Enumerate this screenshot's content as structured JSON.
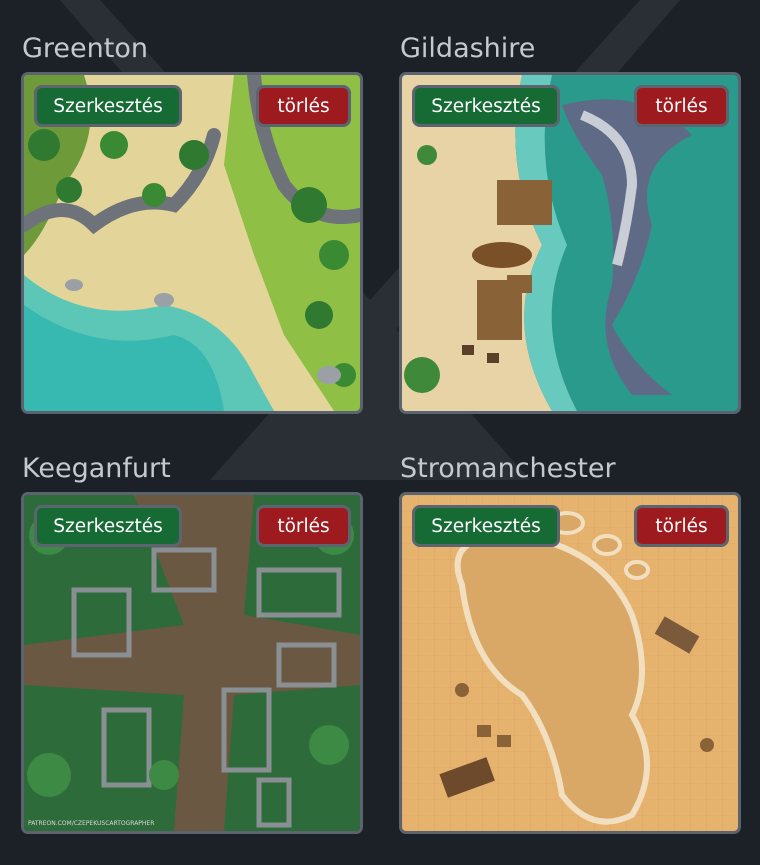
{
  "maps": [
    {
      "name": "Greenton",
      "edit_label": "Szerkesztés",
      "delete_label": "törlés"
    },
    {
      "name": "Gildashire",
      "edit_label": "Szerkesztés",
      "delete_label": "törlés"
    },
    {
      "name": "Keeganfurt",
      "edit_label": "Szerkesztés",
      "delete_label": "törlés"
    },
    {
      "name": "Stromanchester",
      "edit_label": "Szerkesztés",
      "delete_label": "törlés"
    }
  ],
  "watermark_text": "PATREON.COM/CZEPEKUSCARTOGRAPHER",
  "colors": {
    "page_bg": "#1c2128",
    "edit_button": "#166b35",
    "delete_button": "#9d1b1f",
    "frame_border": "#5b636f",
    "title_text": "#c4c9d1"
  }
}
